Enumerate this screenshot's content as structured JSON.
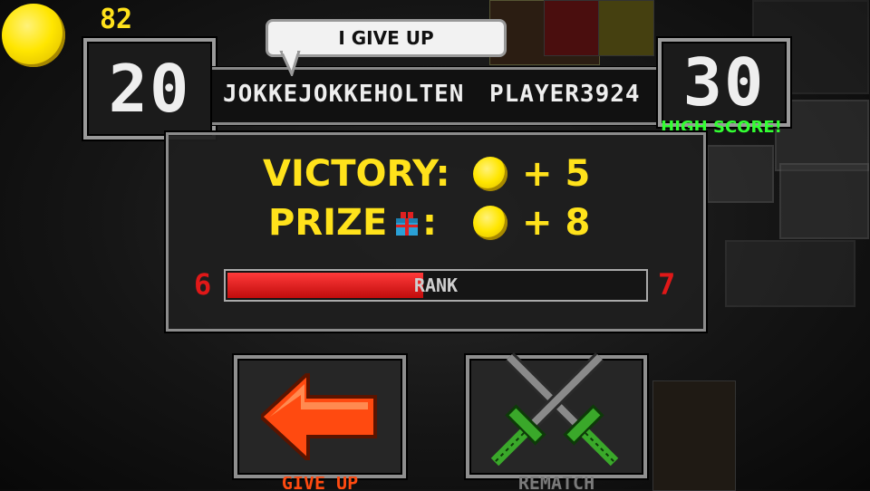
{
  "hud": {
    "coins": "82"
  },
  "player_left": {
    "score": "20",
    "name": "JOKKEJOKKEHOLTEN"
  },
  "player_right": {
    "score": "30",
    "name": "PLAYER3924",
    "badge": "HIGH SCORE!"
  },
  "speech_bubble": {
    "text": "I GIVE UP"
  },
  "results": {
    "victory_label": "VICTORY:",
    "victory_reward": "+ 5",
    "prize_label": "PRIZE",
    "prize_colon": ":",
    "prize_reward": "+ 8"
  },
  "rank": {
    "label": "RANK",
    "current": "6",
    "next": "7",
    "progress": 0.47
  },
  "buttons": {
    "give_up_label": "GIVE UP",
    "rematch_label": "REMATCH"
  },
  "colors": {
    "accent_yellow": "#ffe21b",
    "rank_red": "#e01818",
    "badge_green": "#33ff33",
    "arrow_orange": "#ff4a10",
    "sword_green": "#3aa82a"
  }
}
